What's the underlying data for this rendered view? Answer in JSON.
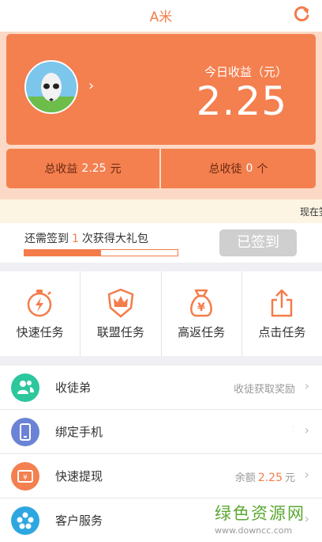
{
  "header": {
    "title": "A米",
    "refresh_icon": "refresh-icon"
  },
  "earnings": {
    "today_label": "今日收益（元）",
    "today_value": "2.25",
    "total_income_label": "总收益",
    "total_income_value": "2.25",
    "total_income_unit": "元",
    "total_apprentices_label": "总收徒",
    "total_apprentices_value": "0",
    "total_apprentices_unit": "个"
  },
  "marquee": {
    "text": "现在签"
  },
  "signin": {
    "prefix": "还需签到",
    "days": "1",
    "suffix": "次获得大礼包",
    "progress": 0.5,
    "button_label": "已签到"
  },
  "tasks": [
    {
      "label": "快速任务",
      "icon": "stopwatch-icon"
    },
    {
      "label": "联盟任务",
      "icon": "crown-shield-icon"
    },
    {
      "label": "高返任务",
      "icon": "money-bag-icon"
    },
    {
      "label": "点击任务",
      "icon": "share-icon"
    }
  ],
  "menu": [
    {
      "label": "收徒弟",
      "value": "收徒获取奖励",
      "icon": "people-icon",
      "color": "#2cc79c"
    },
    {
      "label": "绑定手机",
      "value": "153",
      "icon": "phone-icon",
      "color": "#6b83d6"
    },
    {
      "label": "快速提现",
      "value_prefix": "余额",
      "amount": "2.25",
      "value_unit": "元",
      "icon": "wallet-icon",
      "color": "#f47f4f"
    },
    {
      "label": "客户服务",
      "value": "",
      "icon": "service-icon",
      "color": "#2ea7e0"
    }
  ],
  "watermark": {
    "name": "绿色资源网",
    "url": "www.downcc.com"
  },
  "colors": {
    "accent": "#f47c4a",
    "card": "#f47f4f"
  }
}
